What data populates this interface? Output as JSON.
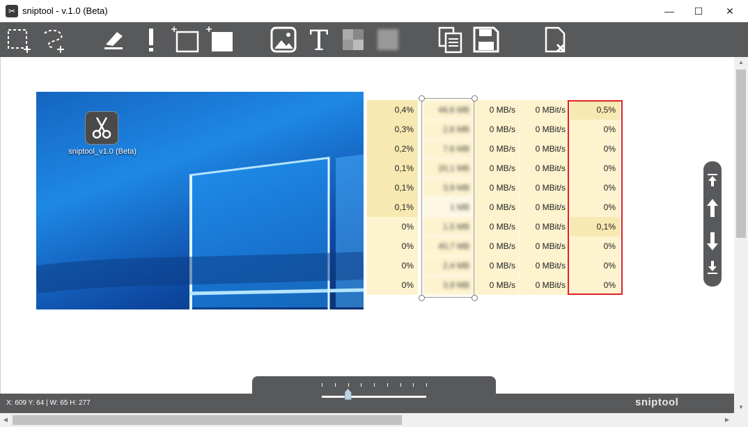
{
  "window": {
    "title": "sniptool - v.1.0 (Beta)",
    "minimize": "—",
    "maximize": "☐",
    "close": "✕"
  },
  "desktop": {
    "icon_label": "sniptool_v1.0 (Beta)"
  },
  "table": {
    "rows": [
      {
        "cpu": "0,4%",
        "mem": "48,6 MB",
        "disk": "0 MB/s",
        "net": "0 MBit/s",
        "gpu": "0,5%"
      },
      {
        "cpu": "0,3%",
        "mem": "2,6 MB",
        "disk": "0 MB/s",
        "net": "0 MBit/s",
        "gpu": "0%"
      },
      {
        "cpu": "0,2%",
        "mem": "7,6 MB",
        "disk": "0 MB/s",
        "net": "0 MBit/s",
        "gpu": "0%"
      },
      {
        "cpu": "0,1%",
        "mem": "20,1 MB",
        "disk": "0 MB/s",
        "net": "0 MBit/s",
        "gpu": "0%"
      },
      {
        "cpu": "0,1%",
        "mem": "3,9 MB",
        "disk": "0 MB/s",
        "net": "0 MBit/s",
        "gpu": "0%"
      },
      {
        "cpu": "0,1%",
        "mem": "1 MB",
        "disk": "0 MB/s",
        "net": "0 MBit/s",
        "gpu": "0%"
      },
      {
        "cpu": "0%",
        "mem": "1,5 MB",
        "disk": "0 MB/s",
        "net": "0 MBit/s",
        "gpu": "0,1%"
      },
      {
        "cpu": "0%",
        "mem": "40,7 MB",
        "disk": "0 MB/s",
        "net": "0 MBit/s",
        "gpu": "0%"
      },
      {
        "cpu": "0%",
        "mem": "2,4 MB",
        "disk": "0 MB/s",
        "net": "0 MBit/s",
        "gpu": "0%"
      },
      {
        "cpu": "0%",
        "mem": "3,9 MB",
        "disk": "0 MB/s",
        "net": "0 MBit/s",
        "gpu": "0%"
      }
    ]
  },
  "status": {
    "coords": "X: 609 Y: 64   |   W: 65 H: 277",
    "brand": "sniptool"
  },
  "zoom": {
    "level": 0.25
  },
  "colors": {
    "toolbar": "#58595b",
    "cell_dark": "#f8e9b2",
    "cell_light": "#fdf3cf",
    "highlight": "#e02020"
  },
  "toolbar_icons": [
    "rect-select-icon",
    "freehand-select-icon",
    "eraser-icon",
    "marker-icon",
    "rect-outline-icon",
    "rect-filled-icon",
    "image-icon",
    "text-icon",
    "pixelate-icon",
    "blur-icon",
    "copy-icon",
    "save-icon",
    "close-file-icon"
  ]
}
